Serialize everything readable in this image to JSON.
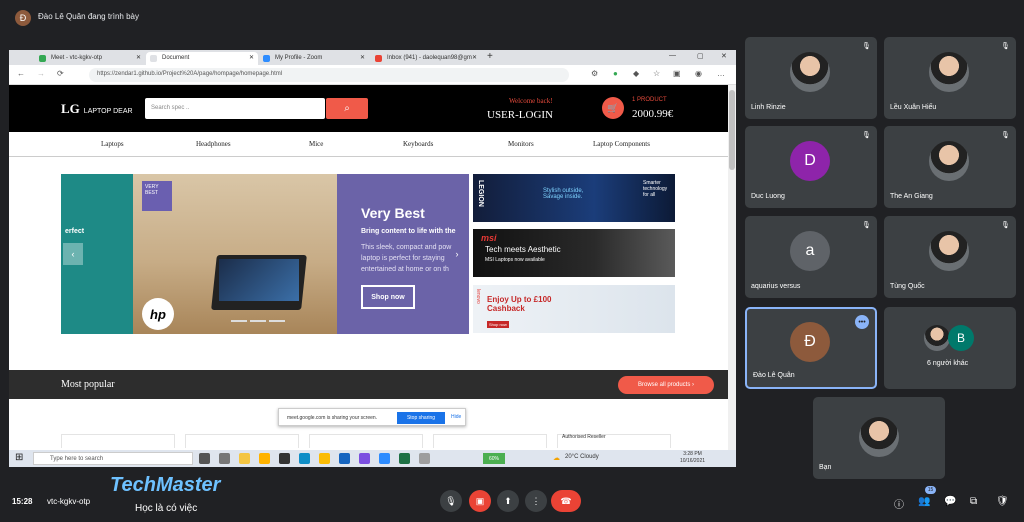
{
  "presenter": {
    "initial": "Đ",
    "text": "Đào Lê Quân đang trình bày"
  },
  "browser": {
    "tabs": [
      {
        "label": "Meet - vtc-kgkv-otp",
        "color": "#34a853"
      },
      {
        "label": "Document",
        "color": "#1a73e8"
      },
      {
        "label": "My Profile - Zoom",
        "color": "#2d8cff"
      },
      {
        "label": "Inbox (941) - daolequan98@gm",
        "color": "#ea4335"
      }
    ],
    "url": "https://zendar1.github.io/Project%20A/page/hompage/homepage.html"
  },
  "site": {
    "logo_mark": "LG",
    "logo_text": "LAPTOP DEAR",
    "search_placeholder": "Search spec ..",
    "welcome": "Welcome back!",
    "user_login": "USER-LOGIN",
    "cart_count": "1 PRODUCT",
    "cart_price": "2000.99€",
    "categories": [
      "Laptops",
      "Headphones",
      "Mice",
      "Keyboards",
      "Monitors",
      "Laptop Components"
    ],
    "banner": {
      "tag": "VERY BEST",
      "left_text": "erfect",
      "title": "Very Best",
      "subtitle": "Bring content to life with the",
      "desc": "This sleek, compact and pow laptop is perfect for staying entertained at home or on th",
      "button": "Shop now"
    },
    "ads": [
      {
        "brand": "LEGION",
        "text": "Stylish outside, Savage inside.",
        "tag": "Smarter technology for all"
      },
      {
        "brand": "msi",
        "text": "Tech meets Aesthetic",
        "tag": "MSI Laptops now available"
      },
      {
        "brand": "lenovo",
        "text": "Enjoy Up to £100 Cashback",
        "tag": "Shop now"
      }
    ],
    "popular_title": "Most popular",
    "browse_all": "Browse all products",
    "authorised": "Authorised Reseller"
  },
  "share_notice": {
    "text": "meet.google.com is sharing your screen.",
    "stop": "Stop sharing",
    "hide": "Hide"
  },
  "taskbar": {
    "search": "Type here to search",
    "battery": "60%",
    "weather": "20°C  Cloudy",
    "time": "3:28 PM",
    "date": "10/16/2021"
  },
  "participants": [
    {
      "name": "Linh Rinzie",
      "type": "photo"
    },
    {
      "name": "Lều Xuân Hiếu",
      "type": "photo"
    },
    {
      "name": "Duc Luong",
      "type": "initial",
      "initial": "D",
      "color": "#8e24aa"
    },
    {
      "name": "The An Giang",
      "type": "photo"
    },
    {
      "name": "aquarius versus",
      "type": "initial",
      "initial": "a",
      "color": "#5f6368"
    },
    {
      "name": "Tùng Quốc",
      "type": "photo"
    },
    {
      "name": "Đào Lê Quân",
      "type": "initial",
      "initial": "Đ",
      "color": "#8d5a3c"
    },
    {
      "name": "6 người khác",
      "type": "group",
      "initial": "B",
      "color": "#00796b"
    }
  ],
  "self": {
    "name": "Bạn"
  },
  "bottom": {
    "time": "15:28",
    "meeting_code": "vtc-kgkv-otp",
    "brand": "TechMaster",
    "slogan": "Học là có việc",
    "participants_badge": "15"
  }
}
